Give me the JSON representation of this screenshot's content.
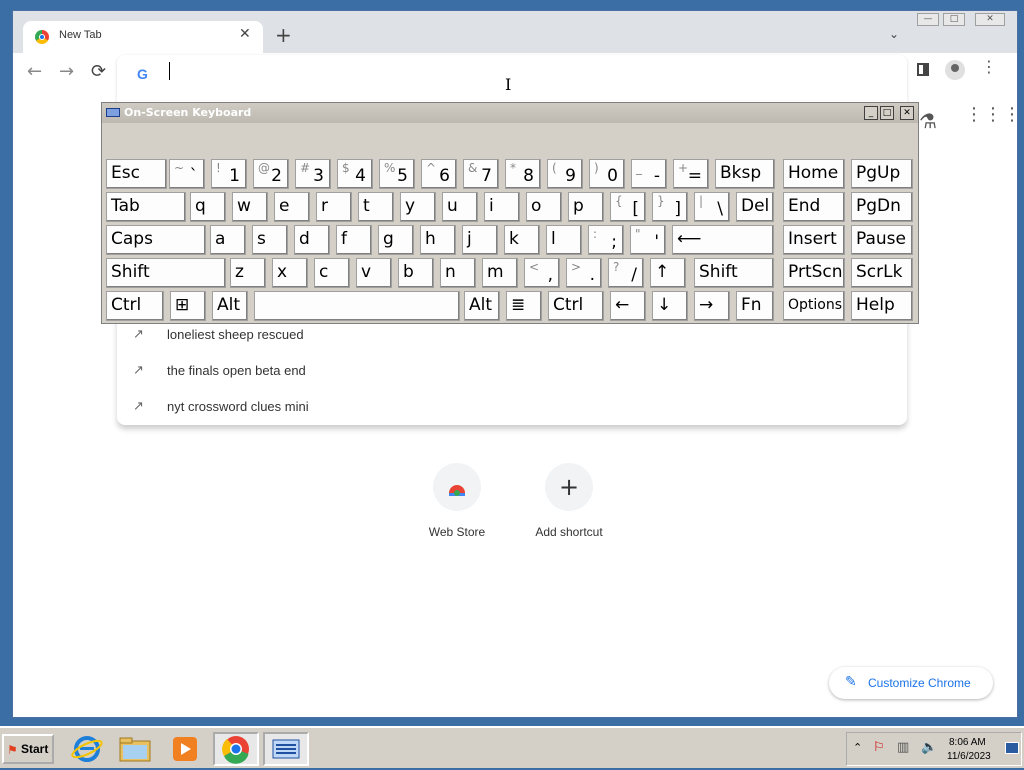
{
  "browser": {
    "tab_title": "New Tab",
    "tab_close": "✕",
    "new_tab": "+",
    "tab_search": "⌄",
    "nav_back": "←",
    "nav_forward": "→",
    "nav_reload": "⟳",
    "search_logo": "G",
    "window_controls": {
      "minimize": "—",
      "maximize": "□",
      "close": "✕"
    }
  },
  "suggestions": [
    {
      "text": "loneliest sheep rescued",
      "icon": "trending-icon"
    },
    {
      "text": "the finals open beta end",
      "icon": "trending-icon"
    },
    {
      "text": "nyt crossword clues mini",
      "icon": "trending-icon"
    }
  ],
  "shortcuts": [
    {
      "label": "Web Store",
      "icon": "web-store-icon"
    },
    {
      "label": "Add shortcut",
      "icon": "plus-icon"
    }
  ],
  "customize_chrome": "Customize Chrome",
  "osk": {
    "title": "On-Screen Keyboard",
    "rows": [
      [
        {
          "m": "Esc"
        },
        {
          "s": "~",
          "b": "`"
        },
        {
          "s": "!",
          "b": "1"
        },
        {
          "s": "@",
          "b": "2"
        },
        {
          "s": "#",
          "b": "3"
        },
        {
          "s": "$",
          "b": "4"
        },
        {
          "s": "%",
          "b": "5"
        },
        {
          "s": "^",
          "b": "6"
        },
        {
          "s": "&",
          "b": "7"
        },
        {
          "s": "*",
          "b": "8"
        },
        {
          "s": "(",
          "b": "9"
        },
        {
          "s": ")",
          "b": "0"
        },
        {
          "s": "_",
          "b": "-"
        },
        {
          "s": "+",
          "b": "="
        },
        {
          "m": "Bksp"
        },
        {
          "m": "Home"
        },
        {
          "m": "PgUp"
        }
      ],
      [
        {
          "m": "Tab"
        },
        {
          "m": "q"
        },
        {
          "m": "w"
        },
        {
          "m": "e"
        },
        {
          "m": "r"
        },
        {
          "m": "t"
        },
        {
          "m": "y"
        },
        {
          "m": "u"
        },
        {
          "m": "i"
        },
        {
          "m": "o"
        },
        {
          "m": "p"
        },
        {
          "s": "{",
          "b": "["
        },
        {
          "s": "}",
          "b": "]"
        },
        {
          "s": "|",
          "b": "\\"
        },
        {
          "m": "Del"
        },
        {
          "m": "End"
        },
        {
          "m": "PgDn"
        }
      ],
      [
        {
          "m": "Caps"
        },
        {
          "m": "a"
        },
        {
          "m": "s"
        },
        {
          "m": "d"
        },
        {
          "m": "f"
        },
        {
          "m": "g"
        },
        {
          "m": "h"
        },
        {
          "m": "j"
        },
        {
          "m": "k"
        },
        {
          "m": "l"
        },
        {
          "s": ":",
          "b": ";"
        },
        {
          "s": "\"",
          "b": "'"
        },
        {
          "m": "⟵"
        },
        {
          "m": "Insert"
        },
        {
          "m": "Pause"
        }
      ],
      [
        {
          "m": "Shift"
        },
        {
          "m": "z"
        },
        {
          "m": "x"
        },
        {
          "m": "c"
        },
        {
          "m": "v"
        },
        {
          "m": "b"
        },
        {
          "m": "n"
        },
        {
          "m": "m"
        },
        {
          "s": "<",
          "b": ","
        },
        {
          "s": ">",
          "b": "."
        },
        {
          "s": "?",
          "b": "/"
        },
        {
          "m": "↑"
        },
        {
          "m": "Shift"
        },
        {
          "m": "PrtScn"
        },
        {
          "m": "ScrLk"
        }
      ],
      [
        {
          "m": "Ctrl"
        },
        {
          "m": "⊞"
        },
        {
          "m": "Alt"
        },
        {
          "m": ""
        },
        {
          "m": "Alt"
        },
        {
          "m": "≣"
        },
        {
          "m": "Ctrl"
        },
        {
          "m": "←"
        },
        {
          "m": "↓"
        },
        {
          "m": "→"
        },
        {
          "m": "Fn"
        },
        {
          "m": "Options"
        },
        {
          "m": "Help"
        }
      ]
    ]
  },
  "taskbar": {
    "start_label": "Start",
    "apps": [
      "ie-icon",
      "explorer-icon",
      "media-player-icon",
      "chrome-icon",
      "osk-icon"
    ],
    "time": "8:06 AM",
    "date": "11/6/2023"
  }
}
